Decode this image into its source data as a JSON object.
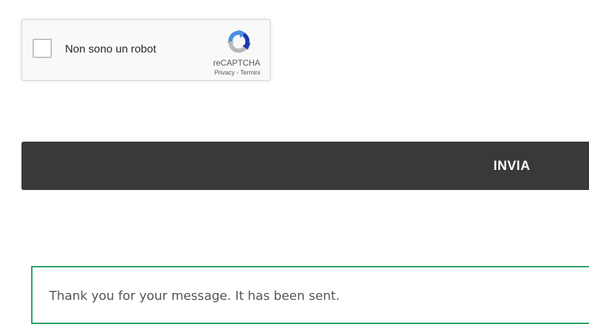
{
  "recaptcha": {
    "checkbox_label": "Non sono un robot",
    "brand": "reCAPTCHA",
    "privacy_link": "Privacy",
    "separator": " - ",
    "terms_link": "Termini",
    "logo_icon": "recaptcha-logo-icon",
    "colors": {
      "blue": "#4a90e2",
      "dark_blue": "#1c3aa9",
      "gray": "#b8b8b8"
    }
  },
  "form": {
    "submit_label": "INVIA"
  },
  "response": {
    "message": "Thank you for your message. It has been sent.",
    "border_color": "#1f9e5c"
  }
}
